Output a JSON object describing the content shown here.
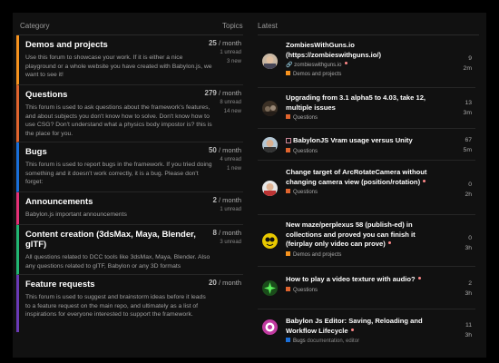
{
  "header": {
    "category": "Category",
    "topics": "Topics",
    "latest": "Latest"
  },
  "colors": {
    "demos": "#f7931e",
    "questions": "#e0642e",
    "bugs": "#1a6fd9",
    "announcements": "#e33177",
    "content": "#22b573",
    "feature": "#6a3ab5"
  },
  "categories": [
    {
      "title": "Demos and projects",
      "desc": "Use this forum to showcase your work. If it is either a nice playground or a whole website you have created with Babylon.js, we want to see it!",
      "rate": "25",
      "unit": "/ month",
      "unread": "1 unread",
      "new": "3 new"
    },
    {
      "title": "Questions",
      "desc": "This forum is used to ask questions about the framework's features, and about subjects you don't know how to solve. Don't know how to use CSG? Don't understand what a physics body impostor is? this is the place for you.",
      "rate": "279",
      "unit": "/ month",
      "unread": "8 unread",
      "new": "14 new"
    },
    {
      "title": "Bugs",
      "desc": "This forum is used to report bugs in the framework. If you tried doing something and it doesn't work correctly, it is a bug. Please don't forget:",
      "rate": "50",
      "unit": "/ month",
      "unread": "4 unread",
      "new": "1 new"
    },
    {
      "title": "Announcements",
      "desc": "Babylon.js important announcements",
      "rate": "2",
      "unit": "/ month",
      "unread": "1 unread",
      "new": ""
    },
    {
      "title": "Content creation (3dsMax, Maya, Blender, glTF)",
      "desc": "All questions related to DCC tools like 3dsMax, Maya, Blender. Also any questions related to glTF, Babylon or any 3D formats",
      "rate": "8",
      "unit": "/ month",
      "unread": "3 unread",
      "new": ""
    },
    {
      "title": "Feature requests",
      "desc": "This forum is used to suggest and brainstorm ideas before it leads to a feature request on the main repo, and ultimately as a list of inspirations for everyone interested to support the framework.",
      "rate": "20",
      "unit": "/ month",
      "unread": "",
      "new": ""
    }
  ],
  "topics": [
    {
      "title": "ZombiesWithGuns.io (https://zombieswithguns.io/)",
      "link": "zombieswithguns.io",
      "category": "Demos and projects",
      "replies": "9",
      "age": "2m"
    },
    {
      "title": "Upgrading from 3.1 alpha5 to 4.03, take 12, multiple issues",
      "category": "Questions",
      "replies": "13",
      "age": "3m"
    },
    {
      "title": "BabylonJS Vram usage versus Unity",
      "category": "Questions",
      "replies": "67",
      "age": "5m"
    },
    {
      "title": "Change target of ArcRotateCamera without changing camera view (position/rotation)",
      "category": "Questions",
      "replies": "0",
      "age": "2h"
    },
    {
      "title": "New maze/perplexus 58 (publish-ed) in collections and proved you can finish it (feirplay only video can prove)",
      "category": "Demos and projects",
      "replies": "0",
      "age": "3h"
    },
    {
      "title": "How to play a video texture with audio?",
      "category": "Questions",
      "replies": "2",
      "age": "3h"
    },
    {
      "title": "Babylon Js Editor: Saving, Reloading and Workflow Lifecycle",
      "category": "Bugs",
      "tags": "documentation, editor",
      "replies": "11",
      "age": "3h"
    }
  ]
}
